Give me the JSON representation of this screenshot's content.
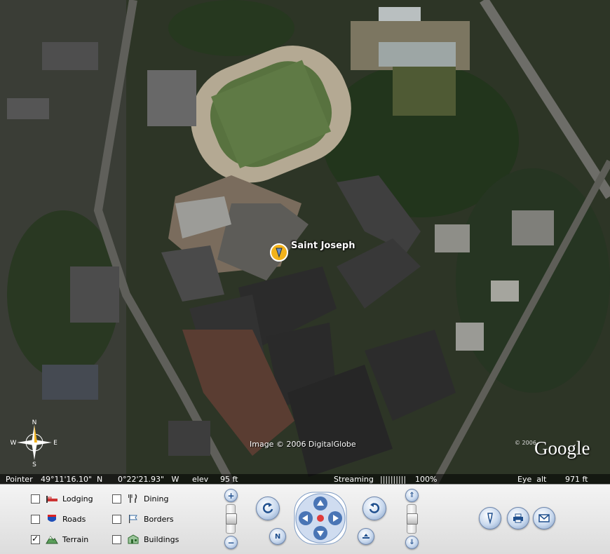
{
  "map": {
    "placemark": "Saint Joseph",
    "credit": "Image © 2006 DigitalGlobe",
    "logo_small": "© 2006",
    "logo": "Google",
    "compass": {
      "n": "N",
      "s": "S",
      "e": "E",
      "w": "W"
    }
  },
  "status": {
    "pointer_label": "Pointer",
    "lat": "49°11'16.10\"  N",
    "lon": "0°22'21.93\"   W",
    "elev_label": "elev",
    "elev_value": "95 ft",
    "streaming_label": "Streaming",
    "streaming_bar": "||||||||||",
    "streaming_pct": "100%",
    "eye_label": "Eye  alt",
    "eye_value": "971 ft"
  },
  "layers": [
    {
      "label": "Lodging",
      "checked": false,
      "icon": "bed-icon"
    },
    {
      "label": "Roads",
      "checked": false,
      "icon": "road-shield-icon"
    },
    {
      "label": "Terrain",
      "checked": true,
      "icon": "mountain-icon"
    },
    {
      "label": "Dining",
      "checked": false,
      "icon": "fork-knife-icon"
    },
    {
      "label": "Borders",
      "checked": false,
      "icon": "flag-icon"
    },
    {
      "label": "Buildings",
      "checked": false,
      "icon": "building-icon"
    }
  ],
  "nav": {
    "zoom_in": "+",
    "zoom_out": "−",
    "north": "N",
    "tilt_up": "⇑",
    "tilt_down": "⇓"
  },
  "colors": {
    "accent_blue": "#1f4f8e",
    "placemark_yellow": "#f2b21a"
  }
}
